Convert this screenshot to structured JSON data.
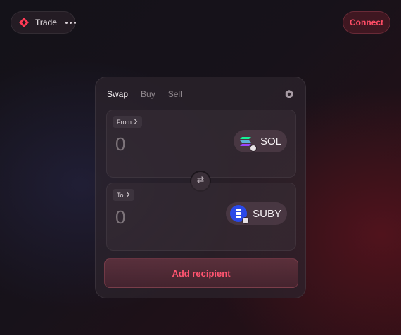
{
  "nav": {
    "label": "Trade",
    "connect_label": "Connect"
  },
  "swap": {
    "tabs": [
      {
        "label": "Swap",
        "active": true
      },
      {
        "label": "Buy",
        "active": false
      },
      {
        "label": "Sell",
        "active": false
      }
    ],
    "from": {
      "label": "From",
      "amount": "0",
      "token": "SOL"
    },
    "to": {
      "label": "To",
      "amount": "0",
      "token": "SUBY"
    },
    "add_recipient_label": "Add recipient"
  },
  "colors": {
    "accent": "#ff4d66",
    "sol_green": "#14f195",
    "sol_purple": "#9945ff",
    "suby_blue": "#2a49e8"
  },
  "icons": {
    "logo": "trade-logo-icon",
    "more": "more-icon",
    "settings": "settings-icon",
    "swap": "swap-arrows-icon",
    "chevron": "chevron-right-icon"
  }
}
